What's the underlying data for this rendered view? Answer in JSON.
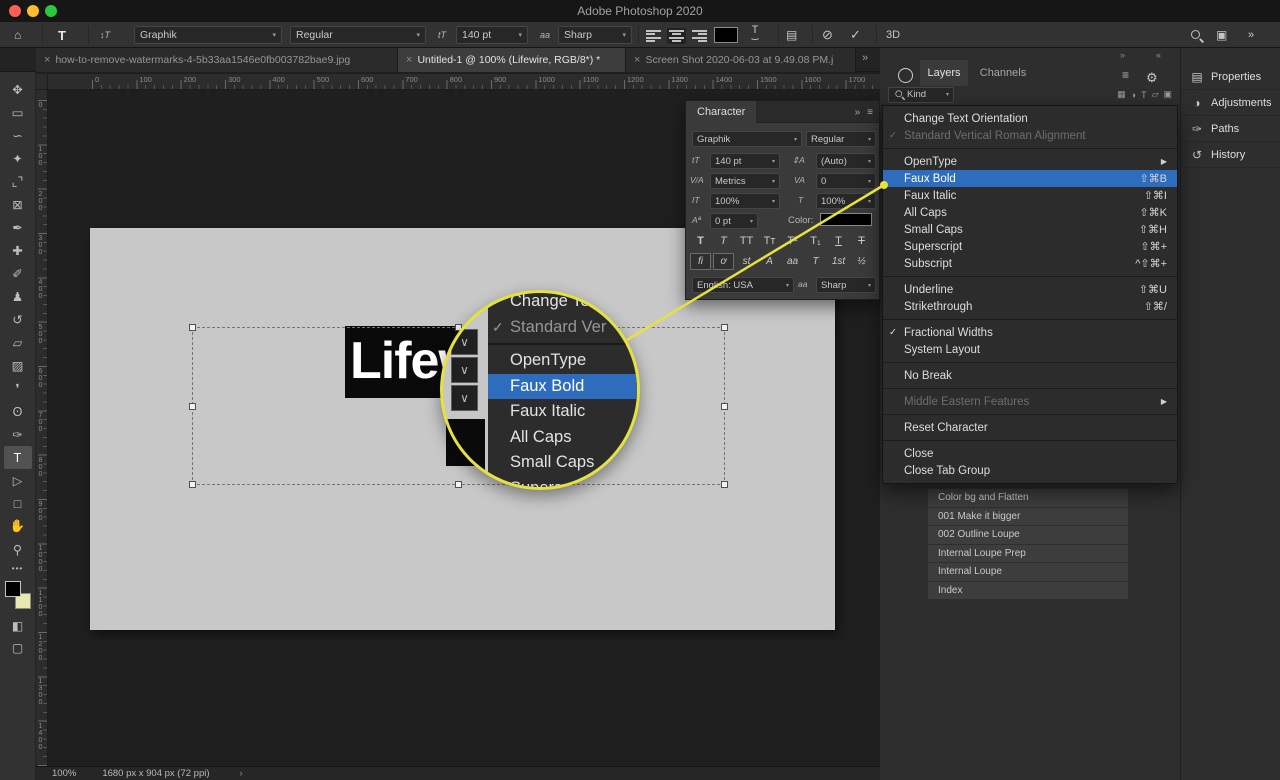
{
  "colors": {
    "menu-highlight": "#2e6cbe",
    "callout-yellow": "#e5e23c",
    "traffic-red": "#ff5f57",
    "traffic-yellow": "#febc2e",
    "traffic-green": "#28c840",
    "foreground-swatch": "#000000",
    "background-swatch": "#e9e9ae",
    "text-color-swatch": "#000000",
    "canvas-bg": "#c8c8c8"
  },
  "icons": {
    "home": "⌂",
    "orientation": "↕T",
    "size": "tT",
    "leading": "⇕A",
    "kerning": "V/A",
    "tracking": "VA",
    "vscale": "IT",
    "hscale": "T",
    "baseline": "Aª",
    "aa": "aa",
    "cancel": "⊘",
    "commit": "✓",
    "check": "✓",
    "workspace": "▣",
    "panels": "▤",
    "overflow": "»",
    "collapse_left": "«",
    "collapse_right": "»",
    "burger": "≡",
    "gear": "⚙",
    "close": "×",
    "submenu_arrow": "▶",
    "chevron_down": "∨",
    "chevron_small": "›",
    "more": "•••",
    "quick_mask": "◧",
    "screen_mode": "▢"
  },
  "titlebar": {
    "title": "Adobe Photoshop 2020"
  },
  "options_bar": {
    "tool_badge": "T",
    "font_family": "Graphik",
    "font_style": "Regular",
    "font_size": "140 pt",
    "anti_alias": "Sharp",
    "threed_label": "3D"
  },
  "tabs": [
    {
      "label": "how-to-remove-watermarks-4-5b33aa1546e0fb003782bae9.jpg",
      "active": false
    },
    {
      "label": "Untitled-1 @ 100% (Lifewire, RGB/8*) *",
      "active": true
    },
    {
      "label": "Screen Shot 2020-06-03 at 9.49.08 PM.j",
      "active": false
    }
  ],
  "toolbar": {
    "tools": [
      {
        "name": "move-tool",
        "glyph": "✥"
      },
      {
        "name": "marquee-tool",
        "glyph": "▭"
      },
      {
        "name": "lasso-tool",
        "glyph": "∽"
      },
      {
        "name": "quick-selection-tool",
        "glyph": "✦"
      },
      {
        "name": "crop-tool",
        "glyph": "⌞⌝"
      },
      {
        "name": "frame-tool",
        "glyph": "⊠"
      },
      {
        "name": "eyedropper-tool",
        "glyph": "✒"
      },
      {
        "name": "healing-brush-tool",
        "glyph": "✚"
      },
      {
        "name": "brush-tool",
        "glyph": "✐"
      },
      {
        "name": "clone-stamp-tool",
        "glyph": "♟"
      },
      {
        "name": "history-brush-tool",
        "glyph": "↺"
      },
      {
        "name": "eraser-tool",
        "glyph": "▱"
      },
      {
        "name": "gradient-tool",
        "glyph": "▨"
      },
      {
        "name": "blur-tool",
        "glyph": "❜"
      },
      {
        "name": "dodge-tool",
        "glyph": "ʘ"
      },
      {
        "name": "pen-tool",
        "glyph": "✑"
      },
      {
        "name": "type-tool",
        "glyph": "T",
        "selected": true
      },
      {
        "name": "path-selection-tool",
        "glyph": "▷"
      },
      {
        "name": "rectangle-tool",
        "glyph": "□"
      },
      {
        "name": "hand-tool",
        "glyph": "✋"
      },
      {
        "name": "zoom-tool",
        "glyph": "⚲"
      }
    ]
  },
  "rulers": {
    "h_values": [
      "0",
      "100",
      "200",
      "300",
      "400",
      "500",
      "600",
      "700",
      "800",
      "900",
      "1000",
      "1100",
      "1200",
      "1300",
      "1400",
      "1500",
      "1600",
      "1700"
    ],
    "v_values": [
      "0",
      "100",
      "200",
      "300",
      "400",
      "500",
      "600",
      "700",
      "800",
      "900",
      "1000",
      "1100",
      "1200",
      "1300",
      "1400"
    ]
  },
  "canvas": {
    "text_content": "Lifew"
  },
  "character_panel": {
    "title": "Character",
    "font_family": "Graphik",
    "font_style": "Regular",
    "font_size": "140 pt",
    "leading": "(Auto)",
    "kerning": "Metrics",
    "tracking": "0",
    "vertical_scale": "100%",
    "horizontal_scale": "100%",
    "baseline_shift": "0 pt",
    "color_label": "Color:",
    "style_buttons": [
      {
        "name": "faux-bold-button",
        "glyph": "T",
        "cls": "b"
      },
      {
        "name": "faux-italic-button",
        "glyph": "T",
        "cls": "i"
      },
      {
        "name": "all-caps-button",
        "glyph": "TT",
        "cls": ""
      },
      {
        "name": "small-caps-button",
        "glyph": "Tᴛ",
        "cls": ""
      },
      {
        "name": "superscript-button",
        "glyph": "T¹",
        "cls": ""
      },
      {
        "name": "subscript-button",
        "glyph": "T₁",
        "cls": ""
      },
      {
        "name": "underline-button",
        "glyph": "T",
        "cls": "u"
      },
      {
        "name": "strikethrough-button",
        "glyph": "T",
        "cls": "s"
      }
    ],
    "opentype_buttons": [
      {
        "name": "ligatures-button",
        "glyph": "fi",
        "boxed": true
      },
      {
        "name": "contextual-alternates-button",
        "glyph": "ơ",
        "boxed": true
      },
      {
        "name": "discretionary-ligatures-button",
        "glyph": "st"
      },
      {
        "name": "swash-button",
        "glyph": "A"
      },
      {
        "name": "stylistic-alternates-button",
        "glyph": "aa"
      },
      {
        "name": "titling-alternates-button",
        "glyph": "T"
      },
      {
        "name": "ordinals-button",
        "glyph": "1st"
      },
      {
        "name": "fractions-button",
        "glyph": "½"
      }
    ],
    "language": "English: USA",
    "anti_alias": "Sharp"
  },
  "context_menu": {
    "items": [
      {
        "label": "Change Text Orientation"
      },
      {
        "label": "Standard Vertical Roman Alignment",
        "disabled": true,
        "checked": true
      },
      {
        "sep": true
      },
      {
        "label": "OpenType",
        "submenu": true
      },
      {
        "label": "Faux Bold",
        "selected": true,
        "shortcut": "⇧⌘B"
      },
      {
        "label": "Faux Italic",
        "shortcut": "⇧⌘I"
      },
      {
        "label": "All Caps",
        "shortcut": "⇧⌘K"
      },
      {
        "label": "Small Caps",
        "shortcut": "⇧⌘H"
      },
      {
        "label": "Superscript",
        "shortcut": "⇧⌘+"
      },
      {
        "label": "Subscript",
        "shortcut": "^⇧⌘+"
      },
      {
        "sep": true
      },
      {
        "label": "Underline",
        "shortcut": "⇧⌘U"
      },
      {
        "label": "Strikethrough",
        "shortcut": "⇧⌘/"
      },
      {
        "sep": true
      },
      {
        "label": "Fractional Widths",
        "checked": true
      },
      {
        "label": "System Layout"
      },
      {
        "sep": true
      },
      {
        "label": "No Break"
      },
      {
        "sep": true
      },
      {
        "label": "Middle Eastern Features",
        "disabled": true,
        "submenu": true
      },
      {
        "sep": true
      },
      {
        "label": "Reset Character"
      },
      {
        "sep": true
      },
      {
        "label": "Close"
      },
      {
        "label": "Close Tab Group"
      }
    ]
  },
  "loupe": {
    "items": [
      {
        "label": "Change Tex"
      },
      {
        "label": "Standard Ver",
        "checked": true,
        "disabled": true
      },
      {
        "sep": true
      },
      {
        "label": "OpenType"
      },
      {
        "label": "Faux Bold",
        "selected": true
      },
      {
        "label": "Faux Italic"
      },
      {
        "label": "All Caps"
      },
      {
        "label": "Small Caps"
      },
      {
        "label": "Superscr"
      }
    ]
  },
  "layers_panel": {
    "tabs": [
      {
        "label": "Layers",
        "active": true
      },
      {
        "label": "Channels",
        "active": false
      }
    ],
    "filter_label": "Kind",
    "filter_icons": [
      {
        "glyph": "▦",
        "name": "filter-pixel-layers-icon"
      },
      {
        "glyph": "◑",
        "name": "filter-adjustment-layers-icon"
      },
      {
        "glyph": "T",
        "name": "filter-type-layers-icon"
      },
      {
        "glyph": "▱",
        "name": "filter-shape-layers-icon"
      },
      {
        "glyph": "▣",
        "name": "filter-smart-objects-icon"
      }
    ]
  },
  "dock": {
    "panels": [
      {
        "label": "Properties",
        "icon": "▤"
      },
      {
        "label": "Adjustments",
        "icon": "◑"
      },
      {
        "label": "Paths",
        "icon": "✑"
      },
      {
        "label": "History",
        "icon": "↺"
      }
    ]
  },
  "history_panel": {
    "items": [
      "Color bg and Flatten",
      "001 Make it bigger",
      "002 Outline Loupe",
      "Internal Loupe Prep",
      "Internal Loupe",
      "Index"
    ]
  },
  "status_bar": {
    "zoom": "100%",
    "doc_info": "1680 px x 904 px (72 ppi)"
  }
}
